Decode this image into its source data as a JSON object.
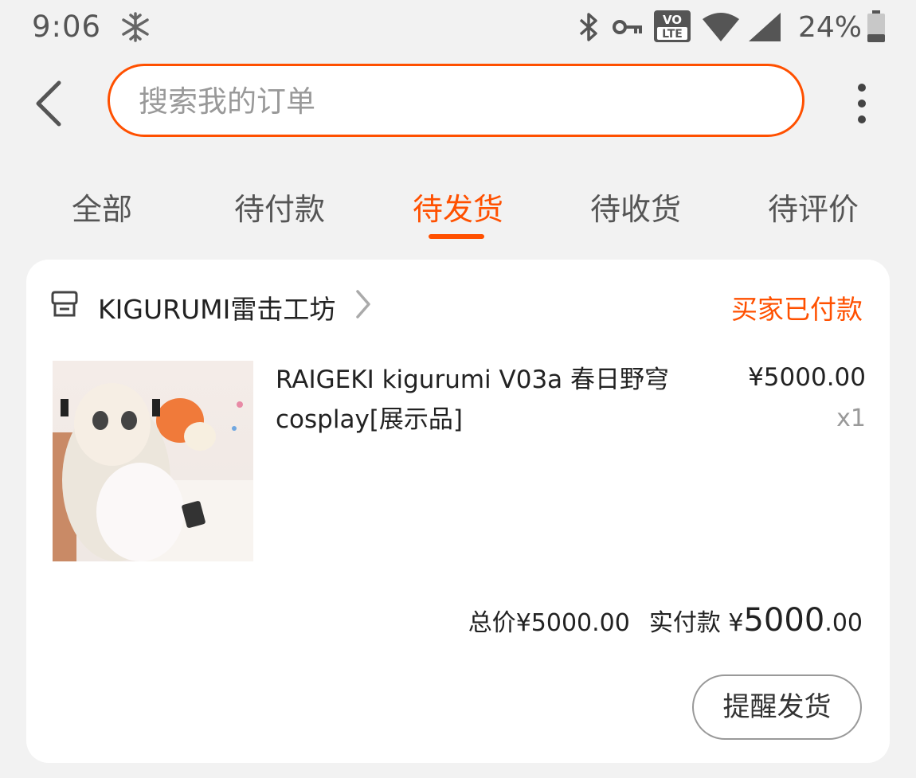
{
  "status_bar": {
    "time": "9:06",
    "battery_percent": "24%",
    "network_badge_top": "VO",
    "network_badge_bottom": "LTE",
    "icons": [
      "snowflake-icon",
      "bluetooth-icon",
      "vpn-key-icon",
      "volte-icon",
      "wifi-icon",
      "cell-signal-icon",
      "battery-icon"
    ]
  },
  "header": {
    "back_icon": "back-chevron-icon",
    "search_placeholder": "搜索我的订单",
    "search_value": "",
    "more_icon": "more-vertical-icon"
  },
  "tabs": [
    {
      "label": "全部",
      "active": false
    },
    {
      "label": "待付款",
      "active": false
    },
    {
      "label": "待发货",
      "active": true
    },
    {
      "label": "待收货",
      "active": false
    },
    {
      "label": "待评价",
      "active": false
    }
  ],
  "order": {
    "shop_name": "KIGURUMI雷击工坊",
    "status": "买家已付款",
    "product": {
      "title": "RAIGEKI kigurumi V03a 春日野穹 cosplay[展示品]",
      "price": "¥5000.00",
      "quantity": "x1"
    },
    "total_label": "总价",
    "total_value": "¥5000.00",
    "paid_label": "实付款",
    "paid_currency": "¥",
    "paid_integer": "5000",
    "paid_decimal": ".00",
    "action_button": "提醒发货"
  },
  "colors": {
    "accent": "#ff5000",
    "background": "#f2f2f2",
    "card": "#ffffff",
    "muted_text": "#999999"
  }
}
